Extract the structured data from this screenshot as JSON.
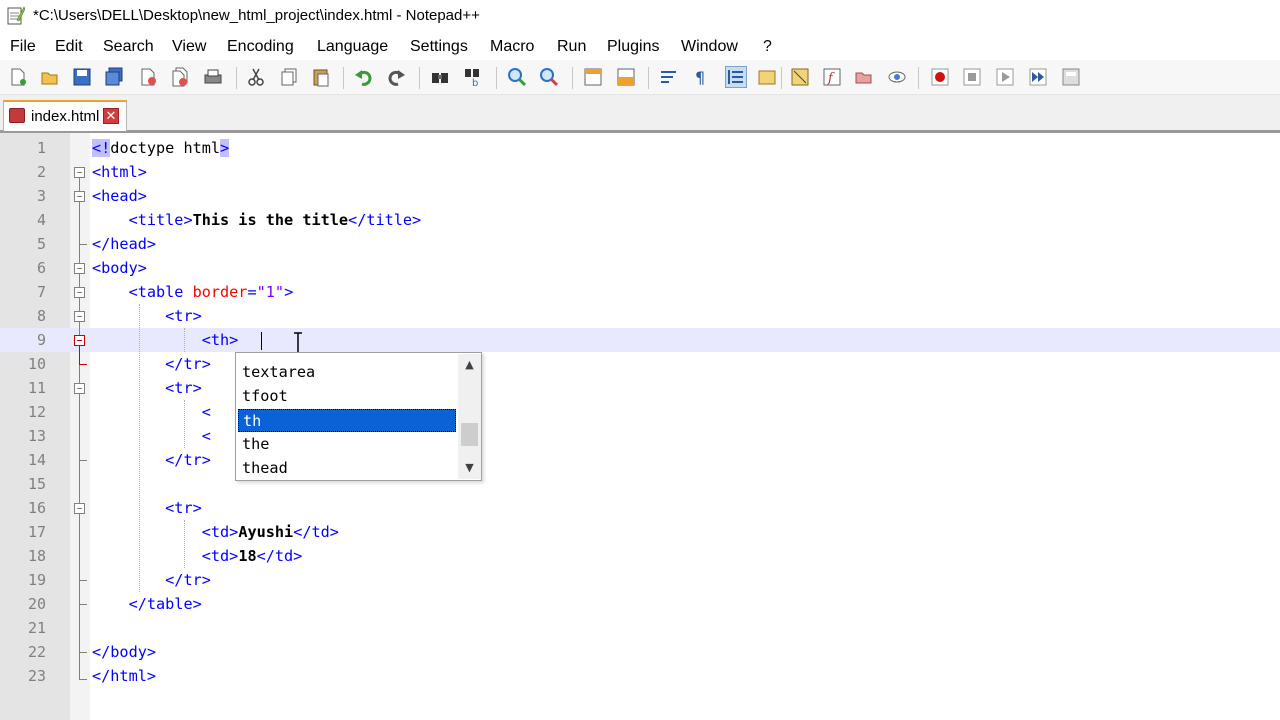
{
  "window": {
    "title": "*C:\\Users\\DELL\\Desktop\\new_html_project\\index.html - Notepad++"
  },
  "menu": {
    "items": [
      "File",
      "Edit",
      "Search",
      "View",
      "Encoding",
      "Language",
      "Settings",
      "Macro",
      "Run",
      "Plugins",
      "Window",
      "?"
    ]
  },
  "toolbar": {
    "icons": [
      "new-file-icon",
      "open-file-icon",
      "save-icon",
      "save-all-icon",
      "close-icon",
      "close-all-icon",
      "print-icon",
      "cut-icon",
      "copy-icon",
      "paste-icon",
      "undo-icon",
      "redo-icon",
      "find-icon",
      "replace-icon",
      "zoom-in-icon",
      "zoom-out-icon",
      "sync-vertical-icon",
      "sync-horizontal-icon",
      "word-wrap-icon",
      "show-all-chars-icon",
      "indent-guide-icon",
      "user-language-icon",
      "document-map-icon",
      "function-list-icon",
      "folder-workspace-icon",
      "monitoring-icon",
      "record-macro-icon",
      "stop-record-icon",
      "play-macro-icon",
      "run-macro-multiple-icon",
      "save-macro-icon"
    ]
  },
  "tab": {
    "label": "index.html",
    "close": "✕"
  },
  "editor": {
    "line_numbers": [
      "1",
      "2",
      "3",
      "4",
      "5",
      "6",
      "7",
      "8",
      "9",
      "10",
      "11",
      "12",
      "13",
      "14",
      "15",
      "16",
      "17",
      "18",
      "19",
      "20",
      "21",
      "22",
      "23"
    ],
    "lines": {
      "l1_open": "<!",
      "l1_mid": "doctype html",
      "l1_close": ">",
      "l2": "<html>",
      "l3": "<head>",
      "l4_indent": "    ",
      "l4_open": "<title>",
      "l4_text": "This is the title",
      "l4_close": "</title>",
      "l5": "</head>",
      "l6": "<body>",
      "l7_indent": "    ",
      "l7_open": "<table ",
      "l7_attr": "border",
      "l7_eq": "=",
      "l7_val": "\"1\"",
      "l7_close": ">",
      "l8_indent": "        ",
      "l8": "<tr>",
      "l9_indent": "            ",
      "l9": "<th>",
      "l10_indent": "        ",
      "l10": "</tr>",
      "l11_indent": "        ",
      "l11": "<tr>",
      "l12_indent": "            ",
      "l12": "<",
      "l13_indent": "            ",
      "l13": "<",
      "l14_indent": "        ",
      "l14": "</tr>",
      "l16_indent": "        ",
      "l16": "<tr>",
      "l17_indent": "            ",
      "l17_open": "<td>",
      "l17_text": "Ayushi",
      "l17_close": "</td>",
      "l18_indent": "            ",
      "l18_open": "<td>",
      "l18_text": "18",
      "l18_close": "</td>",
      "l19_indent": "        ",
      "l19": "</tr>",
      "l20_indent": "    ",
      "l20": "</table>",
      "l22": "</body>",
      "l23": "</html>"
    }
  },
  "autocomplete": {
    "items": [
      "textarea",
      "tfoot",
      "th",
      "the",
      "thead"
    ],
    "selected": "th",
    "scroll_up": "▲",
    "scroll_down": "▼"
  }
}
